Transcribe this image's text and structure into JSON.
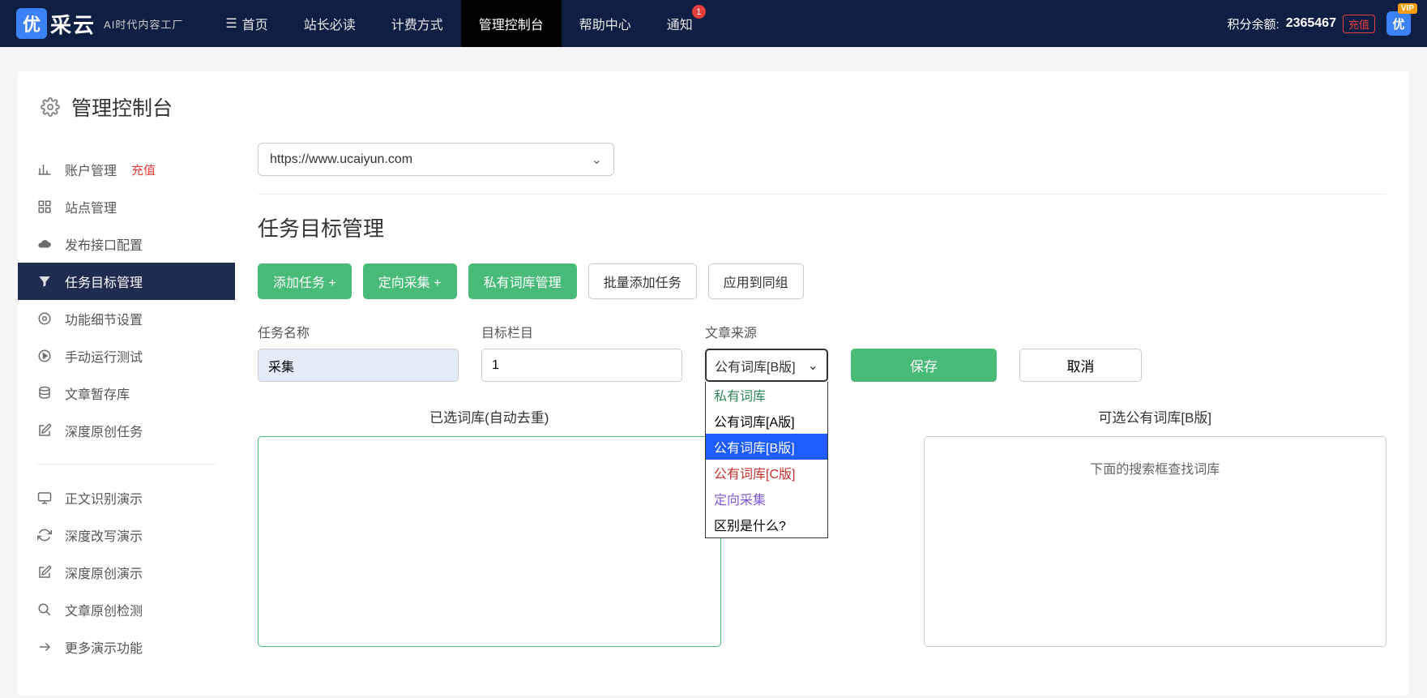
{
  "brand": {
    "badge": "优",
    "name": "采云",
    "tagline": "AI时代内容工厂"
  },
  "nav": {
    "home": "首页",
    "must_read": "站长必读",
    "billing": "计费方式",
    "console": "管理控制台",
    "help": "帮助中心",
    "notify": "通知",
    "notify_count": "1"
  },
  "top_right": {
    "points_label": "积分余额:",
    "points_value": "2365467",
    "recharge": "充值",
    "avatar_text": "优",
    "vip": "VIP"
  },
  "page": {
    "title": "管理控制台"
  },
  "sidebar": {
    "items": [
      {
        "label": "账户管理",
        "extra": "充值"
      },
      {
        "label": "站点管理"
      },
      {
        "label": "发布接口配置"
      },
      {
        "label": "任务目标管理"
      },
      {
        "label": "功能细节设置"
      },
      {
        "label": "手动运行测试"
      },
      {
        "label": "文章暂存库"
      },
      {
        "label": "深度原创任务"
      }
    ],
    "demos": [
      {
        "label": "正文识别演示"
      },
      {
        "label": "深度改写演示"
      },
      {
        "label": "深度原创演示"
      },
      {
        "label": "文章原创检测"
      },
      {
        "label": "更多演示功能"
      }
    ]
  },
  "main": {
    "url": "https://www.ucaiyun.com",
    "section_title": "任务目标管理",
    "buttons": {
      "add_task": "添加任务 +",
      "directed": "定向采集 +",
      "private_lib": "私有词库管理",
      "batch_add": "批量添加任务",
      "apply_group": "应用到同组"
    },
    "form": {
      "task_name_label": "任务名称",
      "task_name_value": "采集",
      "target_col_label": "目标栏目",
      "target_col_value": "1",
      "source_label": "文章来源",
      "source_value": "公有词库[B版]",
      "save": "保存",
      "cancel": "取消"
    },
    "dropdown": {
      "opt_private": "私有词库",
      "opt_a": "公有词库[A版]",
      "opt_b": "公有词库[B版]",
      "opt_c": "公有词库[C版]",
      "opt_directed": "定向采集",
      "opt_diff": "区别是什么?"
    },
    "libs": {
      "left_title": "已选词库(自动去重)",
      "right_title": "可选公有词库[B版]",
      "right_hint": "下面的搜索框查找词库"
    }
  }
}
